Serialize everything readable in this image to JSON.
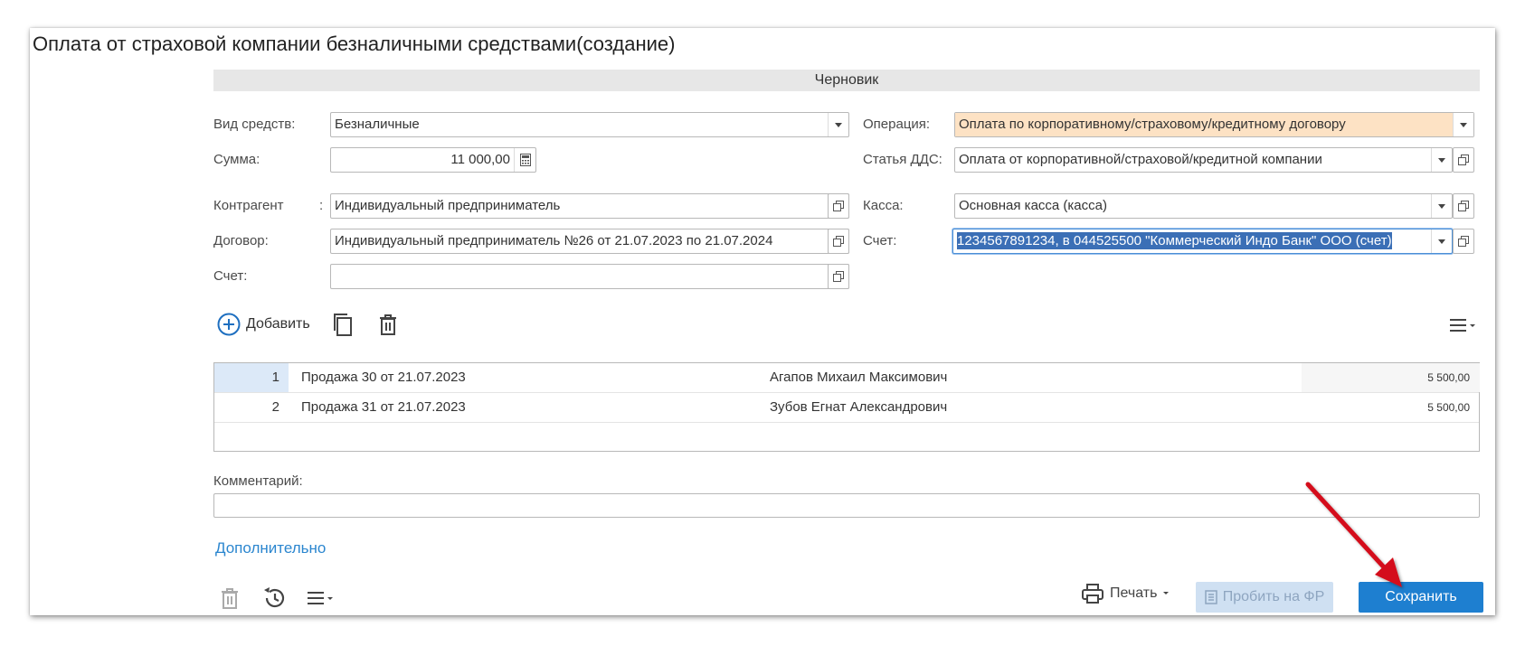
{
  "window": {
    "title": "Оплата от страховой компании безналичными средствами(создание)",
    "status": "Черновик"
  },
  "form": {
    "fund_type": {
      "label": "Вид средств:",
      "value": "Безналичные"
    },
    "amount": {
      "label": "Сумма:",
      "value": "11 000,00"
    },
    "counterparty": {
      "label": "Контрагент",
      "colon": ":",
      "value": "Индивидуальный предприниматель"
    },
    "contract": {
      "label": "Договор:",
      "value": "Индивидуальный предприниматель №26 от 21.07.2023 по 21.07.2024"
    },
    "account_left": {
      "label": "Счет:",
      "value": ""
    },
    "operation": {
      "label": "Операция:",
      "value": "Оплата по корпоративному/страховому/кредитному договору"
    },
    "cashflow_item": {
      "label": "Статья ДДС:",
      "value": "Оплата от корпоративной/страховой/кредитной компании"
    },
    "cashbox": {
      "label": "Касса:",
      "value": "Основная касса (касса)"
    },
    "account_right": {
      "label": "Счет:",
      "value": "1234567891234, в 044525500 \"Коммерческий Индо Банк\" ООО (счет)"
    }
  },
  "toolbar": {
    "add_label": "Добавить"
  },
  "table": {
    "rows": [
      {
        "num": "1",
        "document": "Продажа 30 от 21.07.2023",
        "person": "Агапов Михаил Максимович",
        "sum": "5 500,00"
      },
      {
        "num": "2",
        "document": "Продажа 31 от 21.07.2023",
        "person": "Зубов Егнат Александрович",
        "sum": "5 500,00"
      }
    ]
  },
  "comment": {
    "label": "Комментарий:",
    "value": ""
  },
  "more_link": "Дополнительно",
  "footer": {
    "print_label": "Печать",
    "fr_label": "Пробить на ФР",
    "save_label": "Сохранить"
  },
  "colors": {
    "accent": "#1e7fd0",
    "operation_field_bg": "#fde2c4",
    "arrow": "#d4101a",
    "link": "#2b86cf"
  }
}
